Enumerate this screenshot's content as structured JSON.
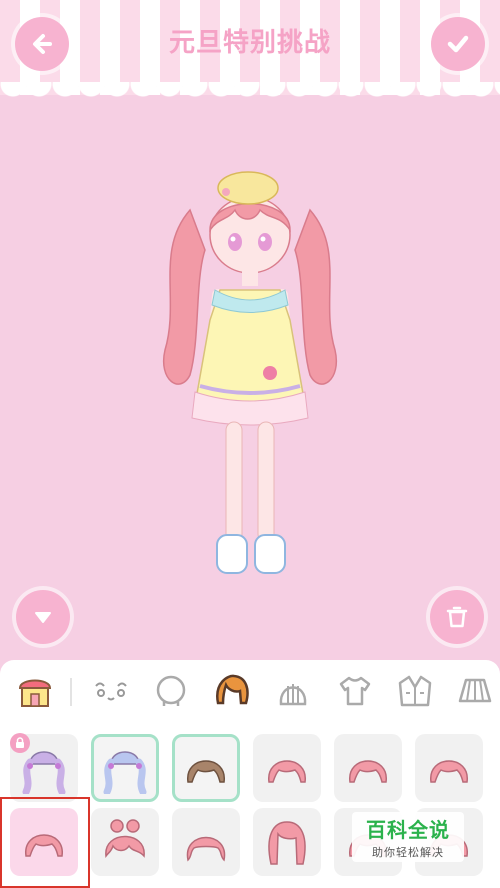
{
  "header": {
    "title": "元旦特别挑战",
    "back_icon": "arrow-left-icon",
    "confirm_icon": "check-icon"
  },
  "colors": {
    "background": "#f6cfe3",
    "accent": "#f7b3d0",
    "title": "#f5a3c6",
    "owned_border": "#a5e1c8",
    "hair": "#f29aa6"
  },
  "stage": {
    "down_icon": "triangle-down-icon",
    "trash_icon": "trash-icon"
  },
  "categories": [
    {
      "name": "shop",
      "icon": "shop-icon"
    },
    {
      "name": "face",
      "icon": "face-icon"
    },
    {
      "name": "head",
      "icon": "head-icon"
    },
    {
      "name": "hair",
      "icon": "hair-icon",
      "active": true
    },
    {
      "name": "back-hair",
      "icon": "back-hair-icon"
    },
    {
      "name": "top",
      "icon": "shirt-icon"
    },
    {
      "name": "jacket",
      "icon": "jacket-icon"
    },
    {
      "name": "skirt",
      "icon": "skirt-icon"
    }
  ],
  "items": [
    {
      "row": 1,
      "col": 1,
      "icon": "twin-tails-purple-icon",
      "color": "#c9b0e6",
      "locked": true
    },
    {
      "row": 1,
      "col": 2,
      "icon": "twin-tails-blue-icon",
      "color": "#b9c6ef",
      "owned": true
    },
    {
      "row": 1,
      "col": 3,
      "icon": "bob-brown-icon",
      "color": "#a8846a",
      "owned": true
    },
    {
      "row": 1,
      "col": 4,
      "icon": "bob-pink-icon",
      "color": "#f29aa6"
    },
    {
      "row": 1,
      "col": 5,
      "icon": "bob-pink-icon",
      "color": "#f29aa6"
    },
    {
      "row": 1,
      "col": 6,
      "icon": "bob-pink-icon",
      "color": "#f29aa6"
    },
    {
      "row": 2,
      "col": 1,
      "icon": "bob-pink-icon",
      "color": "#f29aa6",
      "selected": true
    },
    {
      "row": 2,
      "col": 2,
      "icon": "bun-pink-icon",
      "color": "#f29aa6"
    },
    {
      "row": 2,
      "col": 3,
      "icon": "wavy-pink-icon",
      "color": "#f29aa6"
    },
    {
      "row": 2,
      "col": 4,
      "icon": "long-pink-icon",
      "color": "#f29aa6"
    },
    {
      "row": 2,
      "col": 5,
      "icon": "bob-pink-icon",
      "color": "#f29aa6"
    },
    {
      "row": 2,
      "col": 6,
      "icon": "bob-pink-icon",
      "color": "#f29aa6"
    }
  ],
  "watermark": {
    "main": "百科全说",
    "sub": "助你轻松解决"
  }
}
